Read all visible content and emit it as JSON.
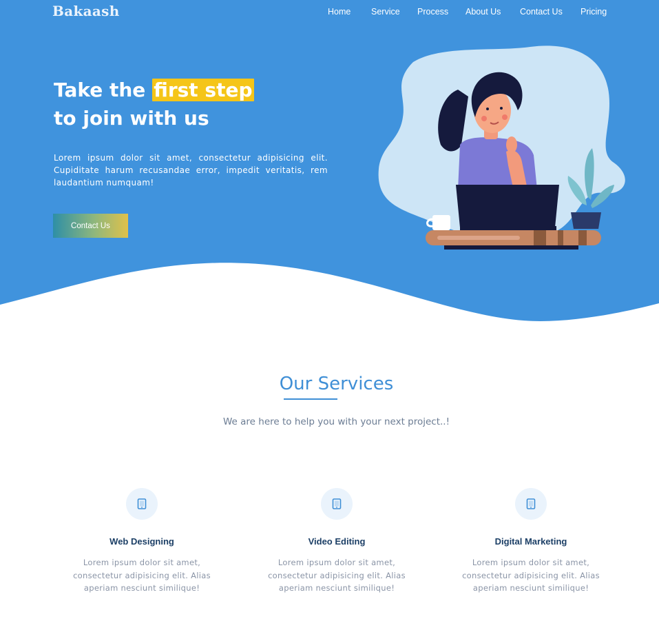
{
  "brand": {
    "logo": "Bakaash"
  },
  "nav": {
    "items": [
      "Home",
      "Service",
      "Process",
      "About Us",
      "Contact Us",
      "Pricing"
    ]
  },
  "hero": {
    "title_pre": "Take the ",
    "title_highlight": "first step",
    "title_line2": "to join with us",
    "description": "Lorem ipsum dolor sit amet, consectetur adipisicing elit. Cupiditate harum recusandae error, impedit veritatis, rem laudantium numquam!",
    "cta_label": "Contact Us"
  },
  "services": {
    "title": "Our Services",
    "subtitle": "We are here to help you with your next project..!",
    "items": [
      {
        "icon": "tablet-icon",
        "title": "Web Designing",
        "text": "Lorem ipsum dolor sit amet, consectetur adipisicing elit. Alias aperiam nesciunt similique!"
      },
      {
        "icon": "tablet-icon",
        "title": "Video Editing",
        "text": "Lorem ipsum dolor sit amet, consectetur adipisicing elit. Alias aperiam nesciunt similique!"
      },
      {
        "icon": "tablet-icon",
        "title": "Digital Marketing",
        "text": "Lorem ipsum dolor sit amet, consectetur adipisicing elit. Alias aperiam nesciunt similique!"
      }
    ]
  },
  "colors": {
    "hero_blue": "#4093dd",
    "accent_yellow": "#f5c518",
    "title_blue": "#3f8fd6",
    "heading_dark": "#1c3f66"
  }
}
